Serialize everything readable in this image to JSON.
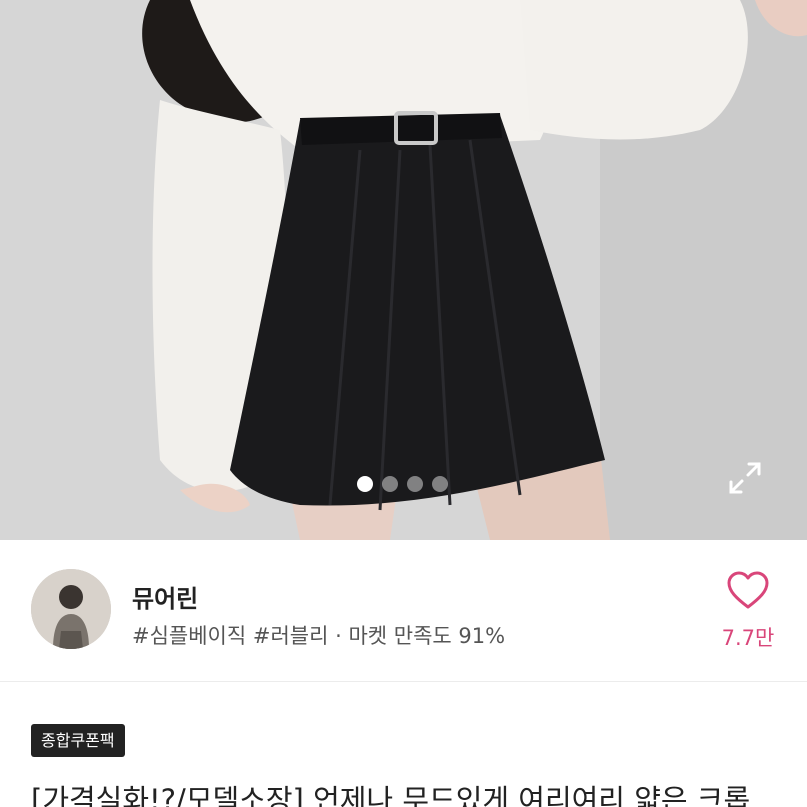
{
  "hero": {
    "image_description": "model-photo",
    "pager": {
      "count": 4,
      "active_index": 0
    },
    "expand_icon": "expand-arrows-icon"
  },
  "seller": {
    "name": "뮤어린",
    "tags": "#심플베이직 #러블리 · 마켓 만족도 91%",
    "avatar_icon": "seller-avatar"
  },
  "like": {
    "icon": "heart-outline-icon",
    "count": "7.7만",
    "color": "#d9467a"
  },
  "product": {
    "badge": "종합쿠폰팩",
    "title": "[가격실화!?/모델소장] 언제나 무드있게 여리여리 얇은 크롭"
  }
}
